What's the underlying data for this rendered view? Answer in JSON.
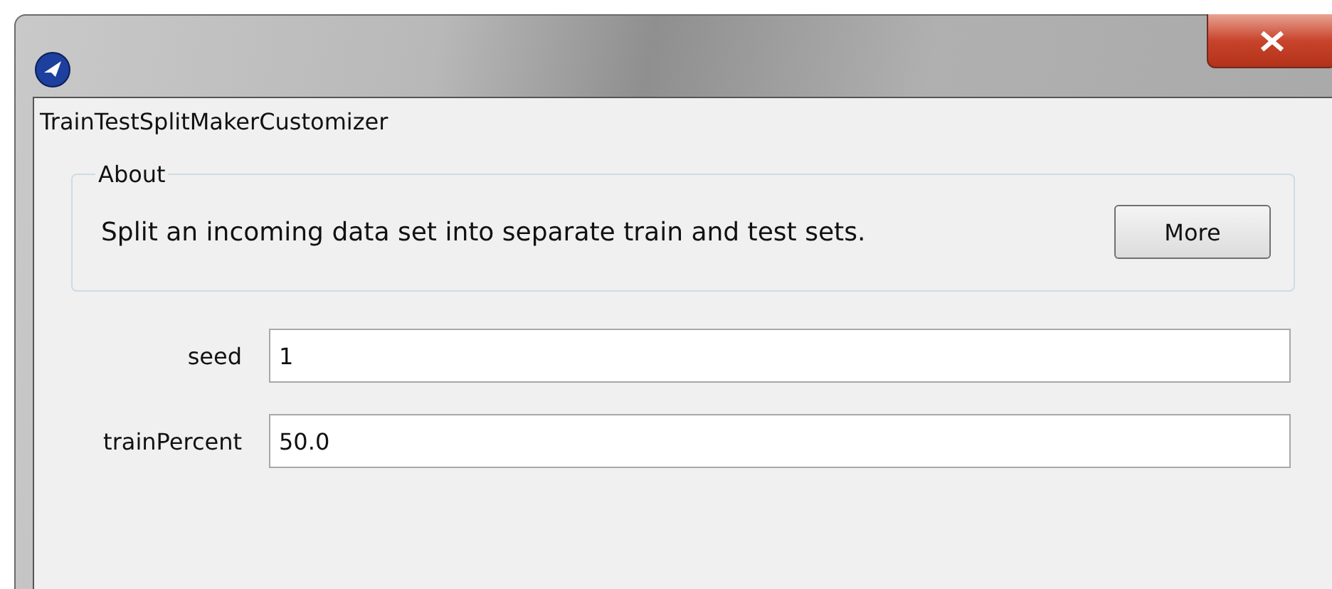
{
  "window": {
    "title": "TrainTestSplitMakerCustomizer"
  },
  "about": {
    "legend": "About",
    "description": "Split an incoming data set into separate train and test sets.",
    "button": "More"
  },
  "fields": [
    {
      "label": "seed",
      "value": "1"
    },
    {
      "label": "trainPercent",
      "value": "50.0"
    }
  ]
}
